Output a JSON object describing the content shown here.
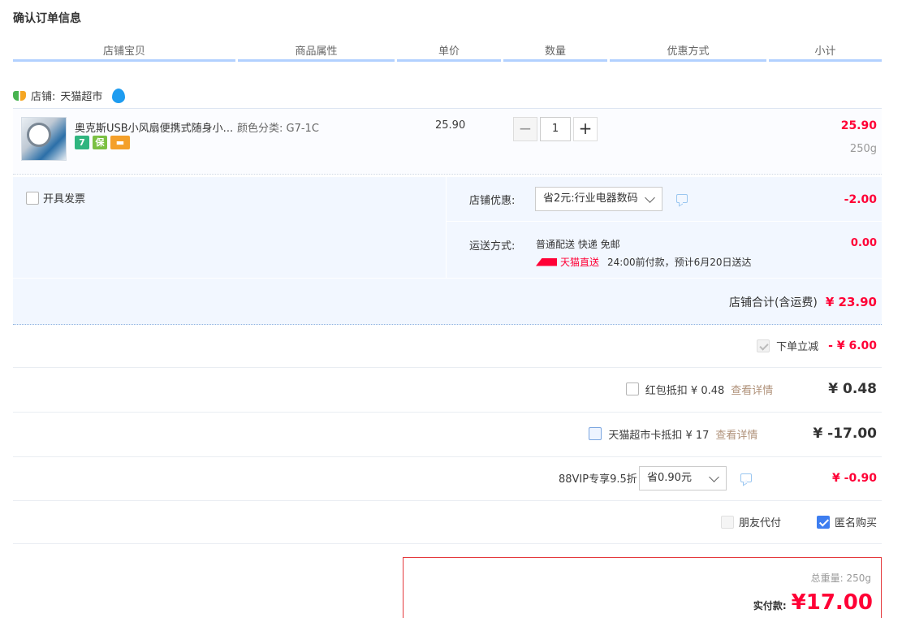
{
  "page_title": "确认订单信息",
  "columns": [
    "店铺宝贝",
    "商品属性",
    "单价",
    "数量",
    "优惠方式",
    "小计"
  ],
  "shop": {
    "label": "店铺:",
    "name": "天猫超市"
  },
  "item": {
    "title": "奥克斯USB小风扇便携式随身小...",
    "attr": "颜色分类:  G7-1C",
    "price": "25.90",
    "qty": "1",
    "qty_minus": "−",
    "qty_plus": "+",
    "subtotal": "25.90",
    "weight": "250g",
    "badges": [
      "7",
      "保",
      "▬"
    ]
  },
  "invoice_label": "开具发票",
  "shop_discount": {
    "label": "店铺优惠:",
    "selected": "省2元:行业电器数码",
    "value": "-2.00"
  },
  "shipping": {
    "label": "运送方式:",
    "method": "普通配送 快递 免邮",
    "tag": "天猫直送",
    "note": "24:00前付款，预计6月20日送达",
    "value": "0.00"
  },
  "shop_total": {
    "label": "店铺合计(含运费)",
    "amount": "¥ 23.90"
  },
  "instant_cut": {
    "label": "下单立减",
    "amount": "- ¥ 6.00"
  },
  "red_packet": {
    "label": "红包抵扣 ¥ 0.48",
    "link": "查看详情",
    "amount": "¥ 0.48"
  },
  "supermarket_card": {
    "label": "天猫超市卡抵扣 ¥ 17",
    "link": "查看详情",
    "amount": "¥ -17.00"
  },
  "vip": {
    "label": "88VIP专享9.5折",
    "selected": "省0.90元",
    "amount": "¥ -0.90"
  },
  "friend_pay_label": "朋友代付",
  "anonymous_label": "匿名购买",
  "pay": {
    "weight": "总重量: 250g",
    "label": "实付款:",
    "amount": "¥17.00"
  }
}
